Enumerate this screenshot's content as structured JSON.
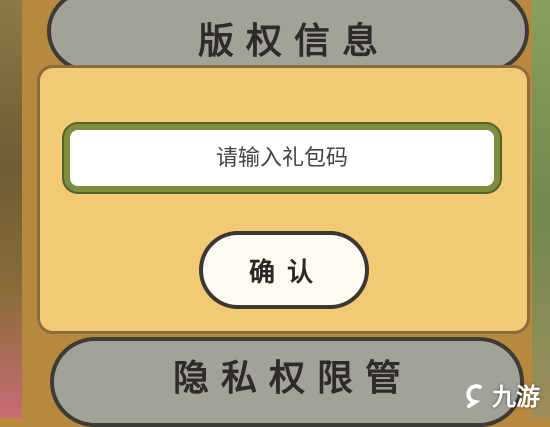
{
  "menu": {
    "copyright_label": "版权信息",
    "privacy_label": "隐私权限管"
  },
  "dialog": {
    "code_placeholder": "请输入礼包码",
    "confirm_label": "确认"
  },
  "watermark": {
    "text": "九游"
  }
}
